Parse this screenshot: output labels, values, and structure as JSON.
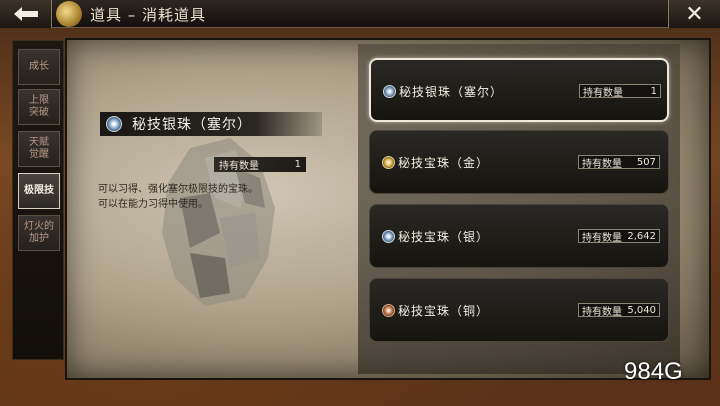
{
  "header": {
    "title": "道具 – 消耗道具",
    "back_icon": "back-arrow-icon",
    "close_label": "✕"
  },
  "tabs": [
    {
      "label": "成长",
      "active": false
    },
    {
      "label": "上限\n突破",
      "active": false
    },
    {
      "label": "天赋\n觉醒",
      "active": false
    },
    {
      "label": "极限技",
      "active": true
    },
    {
      "label": "灯火的\n加护",
      "active": false
    }
  ],
  "detail": {
    "name": "秘技银珠（塞尔）",
    "qty_label": "持有数量",
    "qty_value": "1",
    "description": "可以习得、强化塞尔极限技的宝珠。\n可以在能力习得中使用。"
  },
  "items": [
    {
      "name": "秘技银珠（塞尔）",
      "qty_label": "持有数量",
      "qty": "1",
      "gem": "silver",
      "selected": true
    },
    {
      "name": "秘技宝珠（金）",
      "qty_label": "持有数量",
      "qty": "507",
      "gem": "gold",
      "selected": false
    },
    {
      "name": "秘技宝珠（银）",
      "qty_label": "持有数量",
      "qty": "2,642",
      "gem": "silver",
      "selected": false
    },
    {
      "name": "秘技宝珠（铜）",
      "qty_label": "持有数量",
      "qty": "5,040",
      "gem": "bronze",
      "selected": false
    }
  ],
  "watermark": "984G"
}
